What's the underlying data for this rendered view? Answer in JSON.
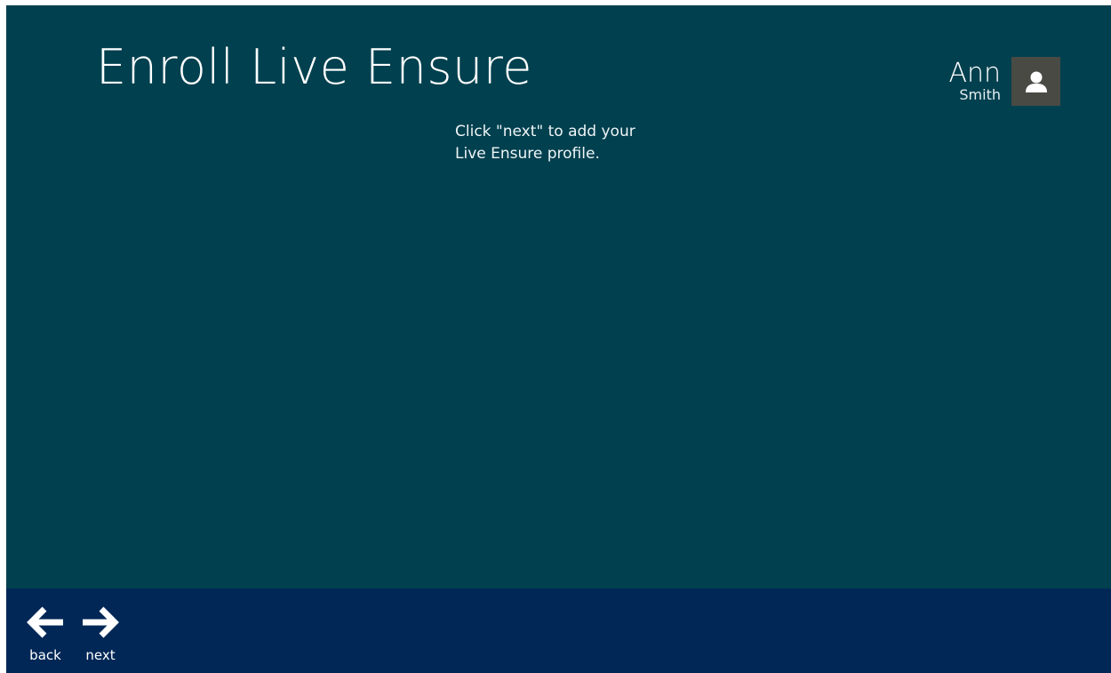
{
  "header": {
    "title": "Enroll Live Ensure"
  },
  "user": {
    "first_name": "Ann",
    "last_name": "Smith",
    "avatar_icon": "user-silhouette-icon"
  },
  "main": {
    "instruction": "Click \"next\" to add your Live Ensure profile."
  },
  "appbar": {
    "back_label": "back",
    "back_icon": "arrow-left-icon",
    "next_label": "next",
    "next_icon": "arrow-right-icon"
  },
  "colors": {
    "background": "#00404f",
    "appbar": "#002756",
    "avatar_tile": "#4a4a45",
    "text": "#ffffff"
  }
}
